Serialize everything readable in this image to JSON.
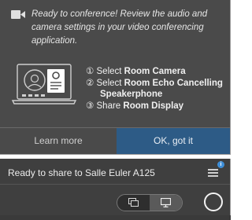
{
  "popover": {
    "message": "Ready to conference! Review the audio and camera settings in your video conferencing application.",
    "steps": {
      "s1_prefix": "① Select ",
      "s1_bold": "Room Camera",
      "s2_prefix": "② Select ",
      "s2_bold": "Room Echo Cancelling",
      "s2_cont": "Speakerphone",
      "s3_prefix": "③ Share ",
      "s3_bold": "Room Display"
    },
    "learn_more_label": "Learn more",
    "ok_label": "OK, got it",
    "icons": {
      "header": "video-camera-icon",
      "illustration": "laptop-settings-icon"
    }
  },
  "bar": {
    "status_text": "Ready to share to Salle Euler A125",
    "notification_count": "i",
    "icons": {
      "menu": "hamburger-menu-icon",
      "window_share": "window-share-icon",
      "display_share": "display-share-icon",
      "circle": "circle-icon"
    }
  },
  "colors": {
    "popover_bg": "#4a4a4a",
    "primary_button": "#2d5b86",
    "bar_bg": "#3f3f3f",
    "notify": "#3f8fd8"
  }
}
